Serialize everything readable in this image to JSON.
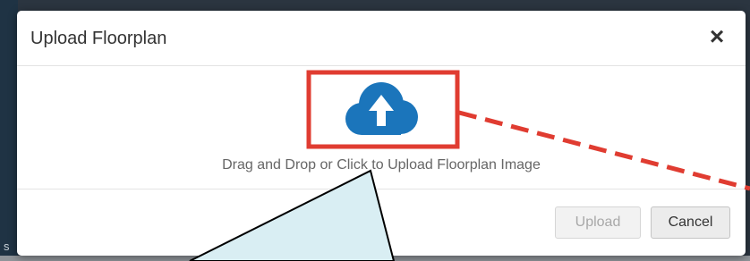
{
  "background": {
    "left_edge_text": "s"
  },
  "modal": {
    "title": "Upload Floorplan",
    "close_label": "×",
    "drop_zone": {
      "icon": "cloud-upload-icon",
      "text": "Drag and Drop or Click to Upload Floorplan Image"
    },
    "footer": {
      "upload_label": "Upload",
      "upload_disabled": true,
      "cancel_label": "Cancel"
    }
  },
  "annotation": {
    "highlight_color": "#e03c31",
    "callout_fill": "#d9eef3"
  },
  "colors": {
    "icon_blue": "#1b75bb"
  }
}
